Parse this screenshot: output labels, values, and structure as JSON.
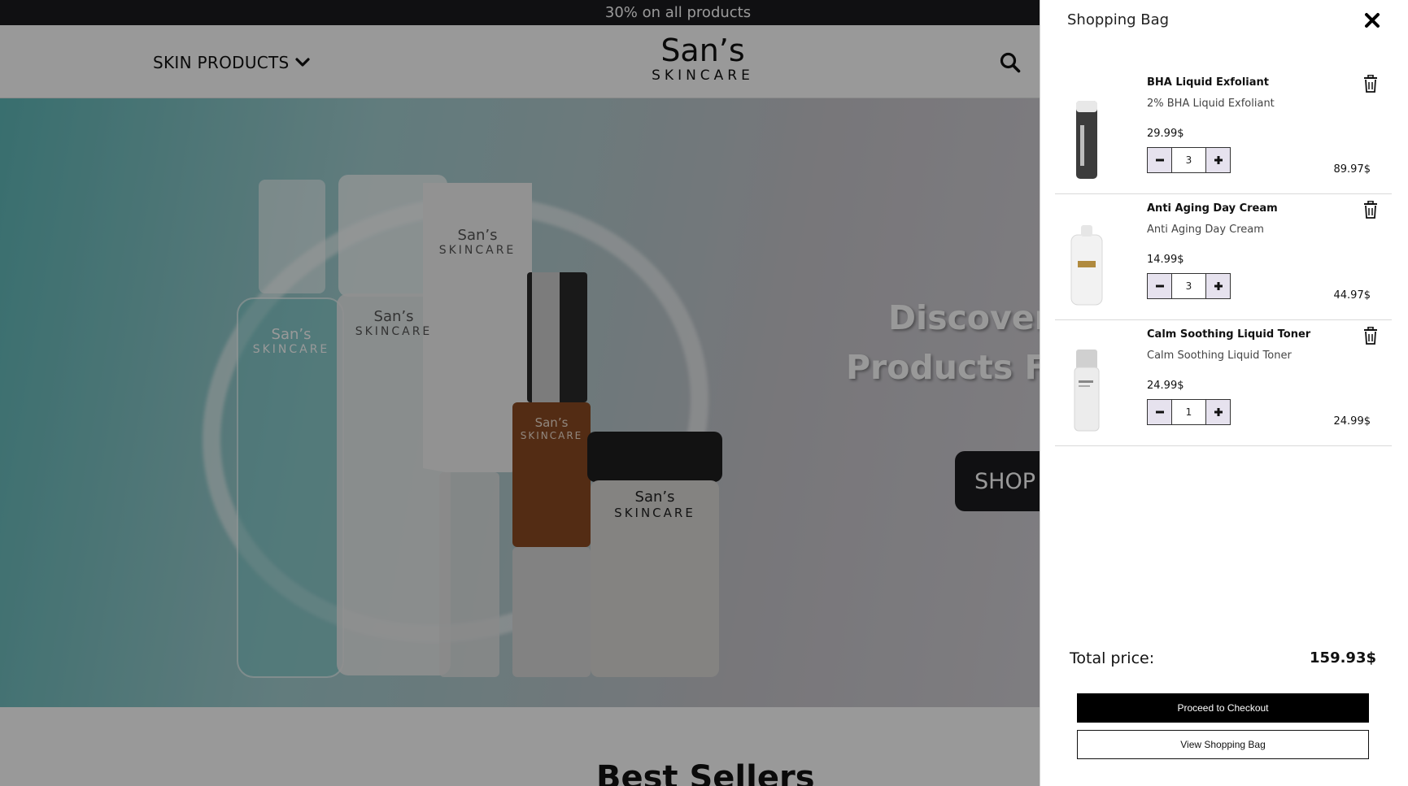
{
  "announcement": "30% on all products",
  "header": {
    "nav_label": "SKIN PRODUCTS",
    "logo_top": "San’s",
    "logo_bottom": "SKINCARE"
  },
  "hero": {
    "headline_line1": "Discover",
    "headline_line2": "Products Fo",
    "shop_button": "SHOP",
    "bottle_brand_top": "San’s",
    "bottle_brand_bottom": "SKINCARE"
  },
  "bestsellers_heading": "Best Sellers",
  "cart": {
    "title": "Shopping Bag",
    "items": [
      {
        "name": "BHA Liquid Exfoliant",
        "description": "2% BHA Liquid Exfoliant",
        "price": "29.99$",
        "quantity": "3",
        "line_total": "89.97$",
        "thumb_color": "#3c3c3c"
      },
      {
        "name": "Anti Aging Day Cream",
        "description": "Anti Aging Day Cream",
        "price": "14.99$",
        "quantity": "3",
        "line_total": "44.97$",
        "thumb_color": "#f2f2f2"
      },
      {
        "name": "Calm Soothing Liquid Toner",
        "description": "Calm Soothing Liquid Toner",
        "price": "24.99$",
        "quantity": "1",
        "line_total": "24.99$",
        "thumb_color": "#ececec"
      }
    ],
    "total_label": "Total price:",
    "total_value": "159.93$",
    "checkout_label": "Proceed to Checkout",
    "view_bag_label": "View Shopping Bag"
  },
  "icons": {
    "nav_chevron": "chevron-down-icon",
    "search": "search-icon",
    "close": "close-icon",
    "delete": "trash-icon",
    "decrement": "minus-icon",
    "increment": "plus-icon"
  },
  "colors": {
    "announcement_bg": "#1c1b1f",
    "qty_button_bg": "#e6e2ee",
    "checkout_bg": "#000000",
    "hero_teal": "#5fb9b9"
  }
}
